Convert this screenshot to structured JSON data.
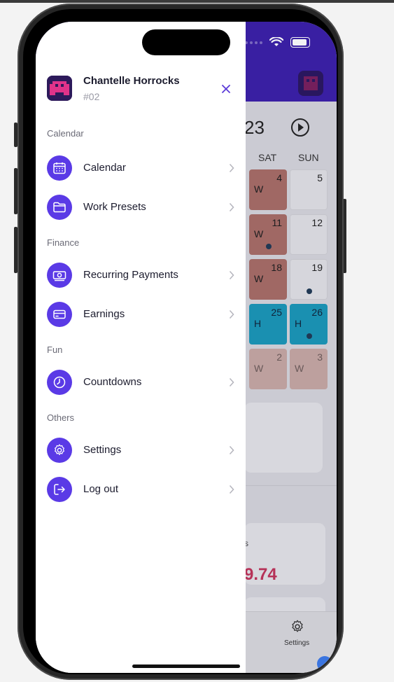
{
  "profile": {
    "name": "Chantelle Horrocks",
    "id": "#02"
  },
  "sections": {
    "calendar": "Calendar",
    "finance": "Finance",
    "fun": "Fun",
    "others": "Others"
  },
  "menu": {
    "calendar": "Calendar",
    "work_presets": "Work Presets",
    "recurring_payments": "Recurring Payments",
    "earnings": "Earnings",
    "countdowns": "Countdowns",
    "settings": "Settings",
    "log_out": "Log out"
  },
  "background": {
    "year_fragment": "23",
    "day_headers": [
      "SAT",
      "SUN"
    ],
    "cells": [
      {
        "sat_num": "4",
        "sat_code": "W",
        "sun_num": "5",
        "sun_code": ""
      },
      {
        "sat_num": "11",
        "sat_code": "W",
        "sun_num": "12",
        "sun_code": ""
      },
      {
        "sat_num": "18",
        "sat_code": "W",
        "sun_num": "19",
        "sun_code": ""
      },
      {
        "sat_num": "25",
        "sat_code": "H",
        "sun_num": "26",
        "sun_code": "H"
      },
      {
        "sat_num": "2",
        "sat_code": "W",
        "sun_num": "3",
        "sun_code": "W"
      }
    ],
    "card_label_fragment": "s",
    "amount_fragment": "9.74",
    "tab_settings": "Settings"
  },
  "colors": {
    "accent": "#5a3ae6",
    "header": "#3b1fa8",
    "work": "#a86d66",
    "holiday": "#1a97b8"
  }
}
